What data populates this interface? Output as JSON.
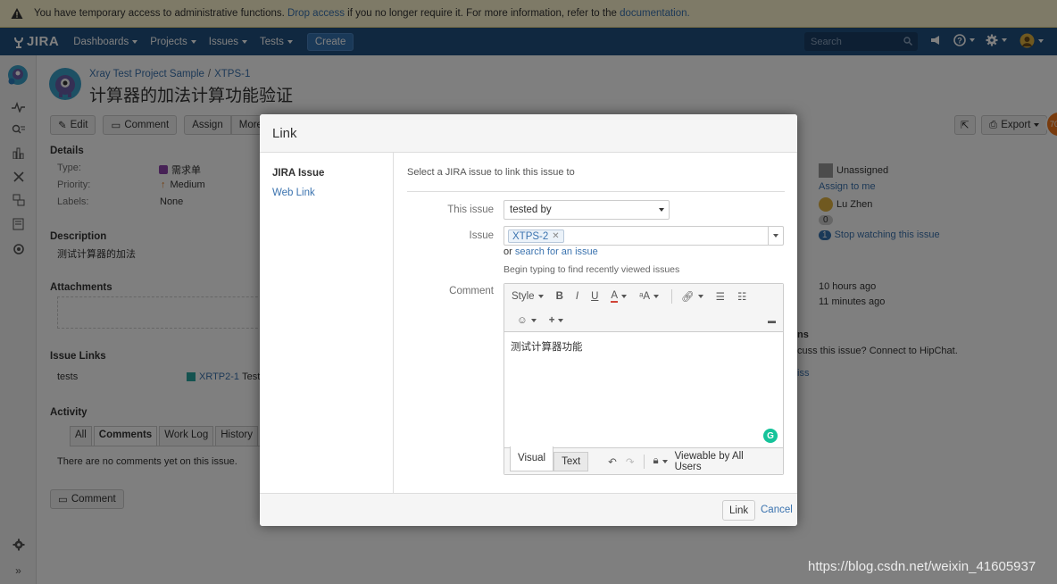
{
  "banner": {
    "text_before": "You have temporary access to administrative functions.",
    "link1": "Drop access",
    "text_middle": "if you no longer require it. For more information, refer to the",
    "link2": "documentation."
  },
  "header": {
    "logo": "JIRA",
    "nav": [
      "Dashboards",
      "Projects",
      "Issues",
      "Tests"
    ],
    "create_label": "Create",
    "search_placeholder": "Search"
  },
  "issue": {
    "project": "Xray Test Project Sample",
    "key": "XTPS-1",
    "title": "计算器的加法计算功能验证",
    "ops": [
      "Edit",
      "Comment",
      "Assign",
      "More"
    ],
    "export_label": "Export",
    "details_heading": "Details",
    "type_label": "Type:",
    "type_value": "需求单",
    "priority_label": "Priority:",
    "priority_value": "Medium",
    "labels_label": "Labels:",
    "labels_value": "None",
    "description_heading": "Description",
    "description": "测试计算器的加法",
    "attachments_heading": "Attachments",
    "issue_links_heading": "Issue Links",
    "link_type": "tests",
    "linked_issue": "XRTP2-1",
    "linked_issue_summary": "Test",
    "activity_heading": "Activity",
    "activity_tabs": [
      "All",
      "Comments",
      "Work Log",
      "History"
    ],
    "no_comments": "There are no comments yet on this issue.",
    "comment_button": "Comment"
  },
  "people": {
    "assignee": "Unassigned",
    "assign_to_me": "Assign to me",
    "reporter": "Lu Zhen",
    "votes": "0",
    "watch_link": "Stop watching this issue",
    "watchers": "1",
    "created": "10 hours ago",
    "updated": "11 minutes ago",
    "hipchat_heading": "ns",
    "hipchat_text": "cuss this issue? Connect to HipChat.",
    "hipchat_link": "iss"
  },
  "dialog": {
    "title": "Link",
    "nav_active": "JIRA Issue",
    "nav_other": "Web Link",
    "intro": "Select a JIRA issue to link this issue to",
    "this_issue_label": "This issue",
    "relation_value": "tested by",
    "issue_label": "Issue",
    "selected_issue": "XTPS-2",
    "or_text": "or",
    "search_link": "search for an issue",
    "hint": "Begin typing to find recently viewed issues",
    "comment_label": "Comment",
    "toolbar": {
      "style": "Style",
      "bold": "B",
      "italic": "I",
      "underline": "U",
      "color": "A"
    },
    "comment_text": "测试计算器功能",
    "tab_visual": "Visual",
    "tab_text": "Text",
    "visibility": "Viewable by All Users",
    "submit": "Link",
    "cancel": "Cancel"
  },
  "watermark": "https://blog.csdn.net/weixin_41605937",
  "colors": {
    "header": "#205081",
    "link": "#3b73af",
    "banner": "#fcf4cf"
  }
}
